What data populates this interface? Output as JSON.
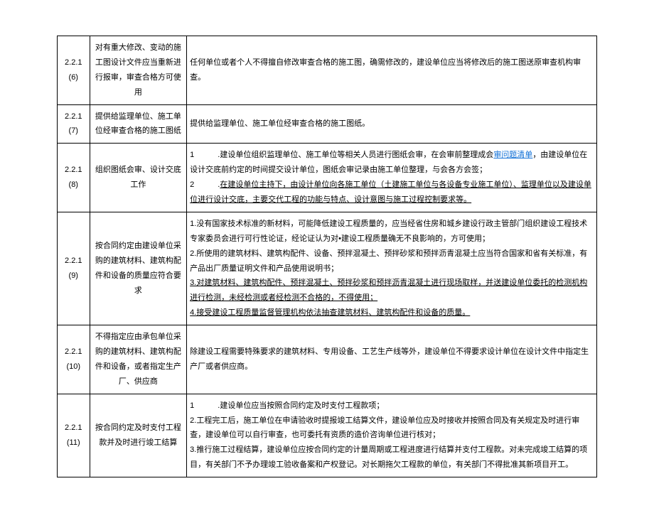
{
  "rows": [
    {
      "id1": "2.2.1",
      "id2": "(6)",
      "title": "对有重大修改、变动的施工图设计文件应当重新进行报审，审查合格方可使用",
      "content_plain": "任何单位或者个人不得擅自修改审查合格的施工图，确需修改的，建设单位应当将修改后的施工图送原审查机构审查。"
    },
    {
      "id1": "2.2.1",
      "id2": "(7)",
      "title": "提供给监理单位、施工单位经审查合格的施工图纸",
      "content_plain": "提供给监理单位、施工单位经审查合格的施工图纸。"
    },
    {
      "id1": "2.2.1",
      "id2": "(8)",
      "title": "组织图纸会审、设计交底工作",
      "content_rich": [
        {
          "segments": [
            {
              "t": "1　　　.建设单位组织监理单位、施工单位等相关人员进行图纸会审，在会审前整理成会"
            },
            {
              "t": "审问题清单",
              "cls": "ul-link"
            },
            {
              "t": "，由建设单位在设计交底前约定的时间提交设计单位，图纸会审记录由施工单位整理，与会各方会签；"
            }
          ]
        },
        {
          "segments": [
            {
              "t": "2　　　."
            },
            {
              "t": "在建设单位主持下，由设计单位向各施工单位（土建施工单位与各设备专业施工单位）、监理单位以及建设单位进行设计交底，主要交代工程的功能与特点、设计意图与施工过程控制要求等。",
              "cls": "ul"
            }
          ]
        }
      ]
    },
    {
      "id1": "2.2.1",
      "id2": "(9)",
      "title": "按合同约定由建设单位采购的建筑材料、建筑构配件和设备的质量应符合要求",
      "content_rich": [
        {
          "segments": [
            {
              "t": "1.没有国家技术标准的新材料，可能降低建设工程质量的，应当经省住房和城乡建设行政主管部门组织建设工程技术专家委员会进行可行性论证，经论证认为对•建设工程质量确无不良影响的，方可使用；"
            }
          ]
        },
        {
          "segments": [
            {
              "t": "2.所使用的建筑材料、建筑构配件、设备、预拌混凝土、预拌砂浆和预拌沥青混凝土应当符合国家和省有关标准，有产品出厂质量证明文件和产品使用说明书；"
            }
          ]
        },
        {
          "segments": [
            {
              "t": "3.对建筑材料、建筑构配件、预拌混凝土、预拌砂浆和预拌沥青混凝土进行现场取样，并送建设单位委托的检测机构进行检测，未经检测或者经检测不合格的，不得使用；",
              "cls": "ul"
            }
          ]
        },
        {
          "segments": [
            {
              "t": "4.接受建设工程质量监督管理机构依法抽查建筑材料、建筑构配件和设备的质量。",
              "cls": "ul"
            }
          ]
        }
      ]
    },
    {
      "id1": "2.2.1",
      "id2": "(10)",
      "title": "不得指定应由承包单位采购的建筑材料、建筑构配件和设备，或者指定生产厂、供应商",
      "content_plain": "除建设工程需要特殊要求的建筑材料、专用设备、工艺生产线等外，建设单位不得要求设计单位在设计文件中指定生产厂或者供应商。"
    },
    {
      "id1": "2.2.1",
      "id2": "(11)",
      "title": "按合同约定及时支付工程款并及时进行竣工结算",
      "content_rich": [
        {
          "segments": [
            {
              "t": "1　　　.建设单位应当按照合同约定及时支付工程款项；"
            }
          ]
        },
        {
          "segments": [
            {
              "t": "2.工程完工后，施工单位在申请验收时提报竣工结算文件，建设单位应及时接收并按照合同及有关规定及时进行审查，建设单位可以自行审查，也可委托有资质的造价咨询单位进行核对；"
            }
          ]
        },
        {
          "segments": [
            {
              "t": "3.推行施工过程结算，建设单位应按合同约定的计量周期或工程进度进行结算并支付工程款。对未完成竣工结算的项目，有关部门不予办理竣工验收备案和产权登记。对长期拖欠工程款的单位，有关部门不得批准其新项目开工。"
            }
          ]
        }
      ]
    }
  ]
}
